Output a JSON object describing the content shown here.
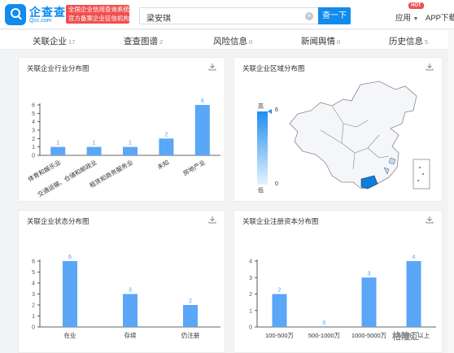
{
  "header": {
    "brand_name": "企查查",
    "brand_domain": "Qcc.com",
    "slogan_line1": "全国企业信用查询系统",
    "slogan_line2": "官方备案企业征信机构",
    "search_value": "梁安琪",
    "search_button": "查一下",
    "nav_apps": "应用",
    "hot_badge": "HOT",
    "nav_app_download": "APP下载"
  },
  "tabs": [
    {
      "label": "关联企业",
      "count": "17"
    },
    {
      "label": "查查图谱",
      "count": "2"
    },
    {
      "label": "风险信息",
      "count": "0"
    },
    {
      "label": "新闻舆情",
      "count": "0"
    },
    {
      "label": "历史信息",
      "count": "5"
    }
  ],
  "panels": {
    "industry_title": "关联企业行业分布图",
    "region_title": "关联企业区域分布图",
    "status_title": "关联企业状态分布图",
    "capital_title": "关联企业注册资本分布图"
  },
  "map_legend": {
    "high": "高",
    "low": "低",
    "max": "6",
    "min": "0",
    "accent": "#1e8ef0"
  },
  "watermark": "格隆汇",
  "chart_data": [
    {
      "type": "bar",
      "categories": [
        "体育和娱乐业",
        "交通运输、仓储和邮政业",
        "租赁和商务服务业",
        "未知",
        "房地产业"
      ],
      "values": [
        1,
        1,
        1,
        2,
        6
      ],
      "ylim": [
        0,
        6
      ],
      "yticks": [
        0,
        1,
        2,
        3,
        4,
        5,
        6
      ],
      "color": "#5aa6f7"
    },
    {
      "type": "bar",
      "categories": [
        "在业",
        "存续",
        "仍注册"
      ],
      "values": [
        6,
        3,
        2
      ],
      "ylim": [
        0,
        6
      ],
      "yticks": [
        0,
        1,
        2,
        3,
        4,
        5,
        6
      ],
      "color": "#5aa6f7"
    },
    {
      "type": "bar",
      "categories": [
        "100-500万",
        "500-1000万",
        "1000-5000万",
        "5000万以上"
      ],
      "values": [
        2,
        0,
        3,
        4
      ],
      "ylim": [
        0,
        4
      ],
      "yticks": [
        0,
        1,
        2,
        3,
        4
      ],
      "color": "#5aa6f7"
    }
  ]
}
